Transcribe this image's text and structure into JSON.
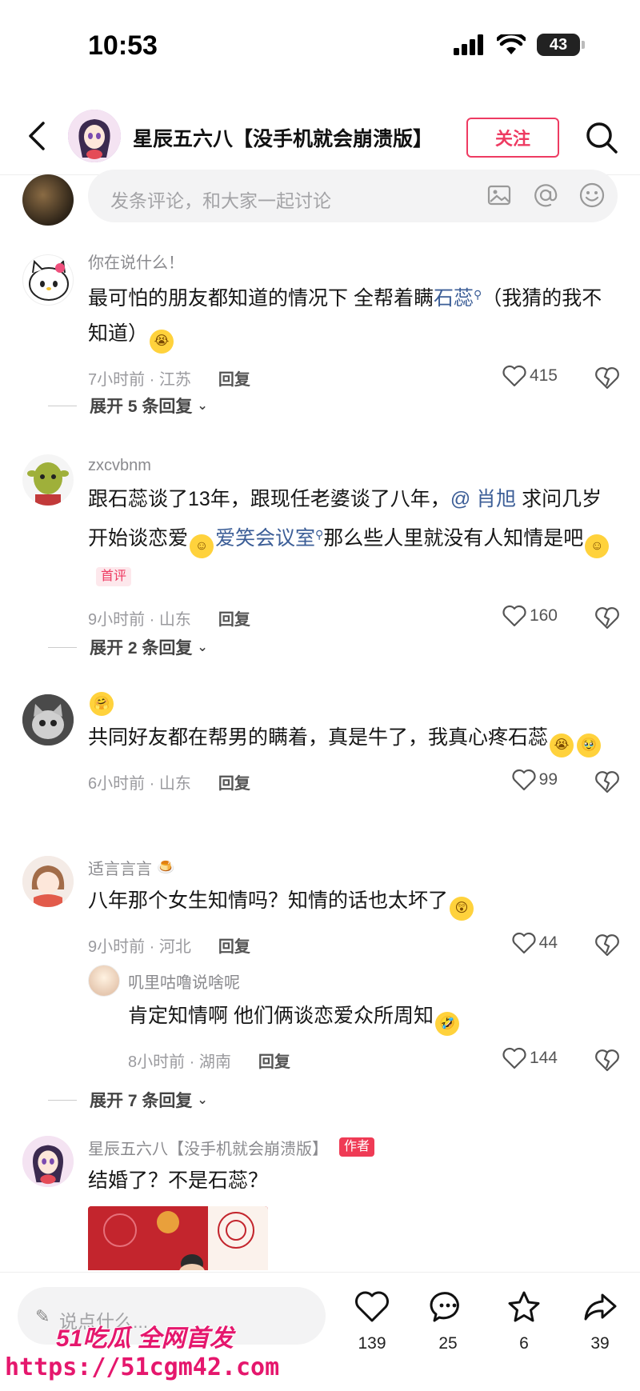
{
  "status": {
    "time": "10:53",
    "battery": "43"
  },
  "header": {
    "title": "星辰五六八【没手机就会崩溃版】",
    "follow_label": "关注"
  },
  "comment_input": {
    "placeholder": "发条评论，和大家一起讨论"
  },
  "comments": [
    {
      "user": "你在说什么！",
      "text_a": "最可怕的朋友都知道的情况下 全帮着瞒",
      "link": "石蕊",
      "text_b": "（我猜的我不知道）",
      "time_loc": "7小时前 · 江苏",
      "reply_label": "回复",
      "likes": "415",
      "expand": "展开 5 条回复"
    },
    {
      "user": "zxcvbnm",
      "text_a": "跟石蕊谈了13年，跟现任老婆谈了八年，",
      "mention": "@ 肖旭",
      "text_b": " 求问几岁开始谈恋爱",
      "link": "爱笑会议室",
      "text_c": "那么些人里就没有人知情是吧",
      "badge": "首评",
      "time_loc": "9小时前 · 山东",
      "reply_label": "回复",
      "likes": "160",
      "expand": "展开 2 条回复"
    },
    {
      "user": "",
      "text": "共同好友都在帮男的瞒着，真是牛了，我真心疼石蕊",
      "time_loc": "6小时前 · 山东",
      "reply_label": "回复",
      "likes": "99"
    },
    {
      "user": "适言言言",
      "text": "八年那个女生知情吗？知情的话也太坏了",
      "time_loc": "9小时前 · 河北",
      "reply_label": "回复",
      "likes": "44",
      "sub_reply": {
        "user": "叽里咕噜说啥呢",
        "text": "肯定知情啊 他们俩谈恋爱众所周知",
        "time_loc": "8小时前 · 湖南",
        "reply_label": "回复",
        "likes": "144"
      },
      "expand": "展开 7 条回复"
    },
    {
      "user": "星辰五六八【没手机就会崩溃版】",
      "author_badge": "作者",
      "text": "结婚了？不是石蕊？"
    }
  ],
  "bottom_bar": {
    "placeholder": "说点什么...",
    "likes": "139",
    "comments": "25",
    "favorites": "6",
    "shares": "39"
  },
  "watermark": {
    "brand": "51吃瓜 全网首发",
    "url": "https://51cgm42.com"
  },
  "colors": {
    "accent": "#ee3b62",
    "link": "#3c5e97",
    "watermark": "#e5176d"
  }
}
